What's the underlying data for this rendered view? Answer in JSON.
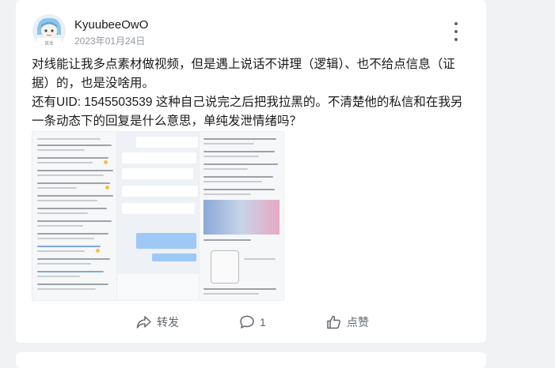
{
  "post": {
    "author": "KyuubeeOwO",
    "date": "2023年01月24日",
    "avatar_caption": "官龙",
    "paragraphs": [
      "对线能让我多点素材做视频，但是遇上说话不讲理（逻辑）、也不给点信息（证据）的，也是没啥用。",
      "还有UID: 1545503539 这种自己说完之后把我拉黑的。不清楚他的私信和在我另一条动态下的回复是什么意思，单纯发泄情绪吗？"
    ]
  },
  "images": [
    {
      "name": "screenshot-comments"
    },
    {
      "name": "screenshot-chat"
    },
    {
      "name": "screenshot-replies"
    }
  ],
  "actions": {
    "share_label": "转发",
    "comment_count": "1",
    "like_label": "点赞"
  },
  "colors": {
    "accent_blue": "#9ec8f5",
    "text_primary": "#18191c",
    "text_secondary": "#9499a0"
  }
}
